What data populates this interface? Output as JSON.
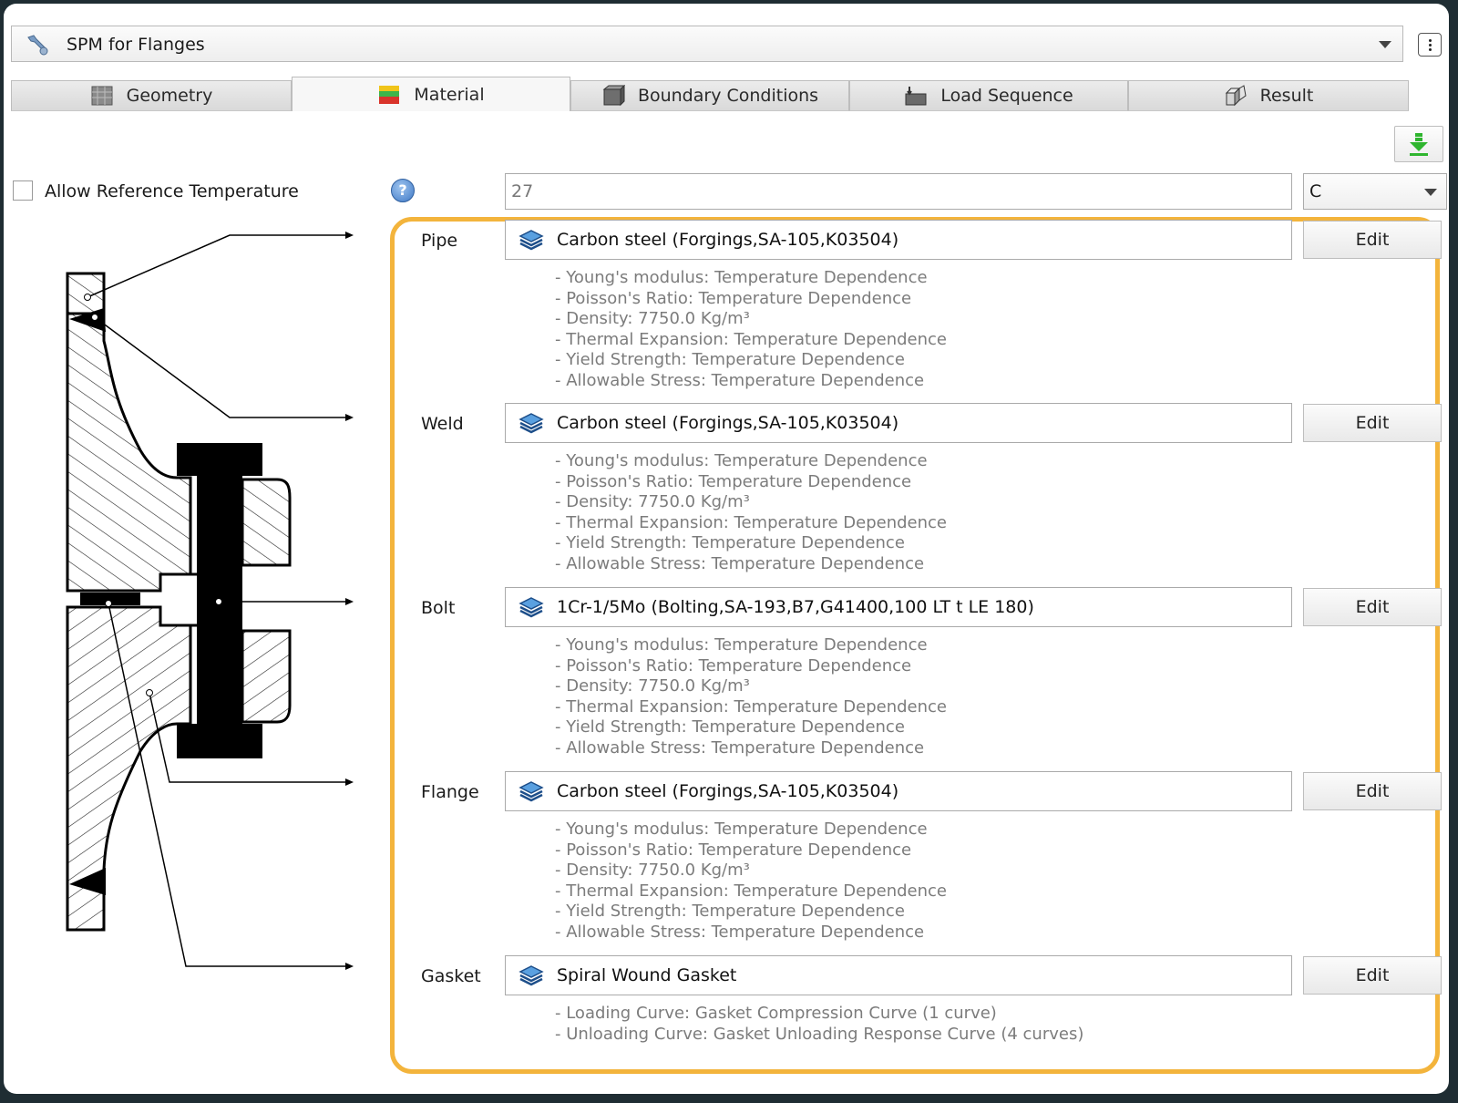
{
  "header": {
    "title": "SPM for Flanges"
  },
  "tabs": [
    {
      "label": "Geometry",
      "icon": "geometry-icon"
    },
    {
      "label": "Material",
      "icon": "material-icon",
      "active": true
    },
    {
      "label": "Boundary Conditions",
      "icon": "boundary-conditions-icon"
    },
    {
      "label": "Load Sequence",
      "icon": "load-sequence-icon"
    },
    {
      "label": "Result",
      "icon": "result-icon"
    }
  ],
  "reference": {
    "checkbox_label": "Allow Reference Temperature",
    "checked": false,
    "temperature_value": "27",
    "unit": "C"
  },
  "materials": [
    {
      "label": "Pipe",
      "material": "Carbon steel (Forgings,SA-105,K03504)",
      "edit_label": "Edit",
      "properties": [
        "- Young's modulus: Temperature Dependence",
        "- Poisson's Ratio: Temperature Dependence",
        "- Density: 7750.0 Kg/m³",
        "- Thermal Expansion: Temperature Dependence",
        "- Yield Strength: Temperature Dependence",
        "- Allowable Stress: Temperature Dependence"
      ]
    },
    {
      "label": "Weld",
      "material": "Carbon steel (Forgings,SA-105,K03504)",
      "edit_label": "Edit",
      "properties": [
        "- Young's modulus: Temperature Dependence",
        "- Poisson's Ratio: Temperature Dependence",
        "- Density: 7750.0 Kg/m³",
        "- Thermal Expansion: Temperature Dependence",
        "- Yield Strength: Temperature Dependence",
        "- Allowable Stress: Temperature Dependence"
      ]
    },
    {
      "label": "Bolt",
      "material": "1Cr-1/5Mo (Bolting,SA-193,B7,G41400,100 LT t LE 180)",
      "edit_label": "Edit",
      "properties": [
        "- Young's modulus: Temperature Dependence",
        "- Poisson's Ratio: Temperature Dependence",
        "- Density: 7750.0 Kg/m³",
        "- Thermal Expansion: Temperature Dependence",
        "- Yield Strength: Temperature Dependence",
        "- Allowable Stress: Temperature Dependence"
      ]
    },
    {
      "label": "Flange",
      "material": "Carbon steel (Forgings,SA-105,K03504)",
      "edit_label": "Edit",
      "properties": [
        "- Young's modulus: Temperature Dependence",
        "- Poisson's Ratio: Temperature Dependence",
        "- Density: 7750.0 Kg/m³",
        "- Thermal Expansion: Temperature Dependence",
        "- Yield Strength: Temperature Dependence",
        "- Allowable Stress: Temperature Dependence"
      ]
    },
    {
      "label": "Gasket",
      "material": "Spiral Wound Gasket",
      "edit_label": "Edit",
      "properties": [
        "- Loading Curve: Gasket Compression Curve (1 curve)",
        "- Unloading Curve: Gasket Unloading Response Curve (4 curves)"
      ]
    }
  ],
  "colors": {
    "highlight": "#f3b43c",
    "download_arrow": "#2fb52f"
  }
}
